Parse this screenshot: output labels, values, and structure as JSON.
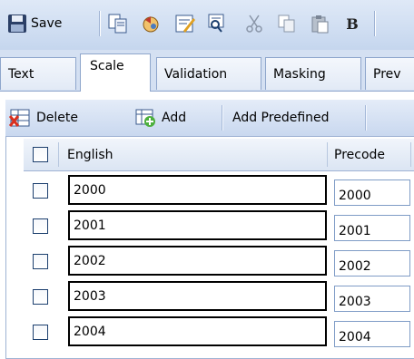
{
  "toolbar": {
    "save_label": "Save",
    "bold_label": "B",
    "buttons": [
      "save-icon",
      "copy-icon",
      "undo-icon",
      "spellcheck-icon",
      "find-replace-icon",
      "cut-icon",
      "copy-small-icon",
      "paste-icon",
      "bold-icon"
    ]
  },
  "tabs": [
    {
      "label": "Text",
      "active": false
    },
    {
      "label": "Scale",
      "active": true
    },
    {
      "label": "Validation",
      "active": false
    },
    {
      "label": "Masking",
      "active": false
    },
    {
      "label": "Prev",
      "active": false
    }
  ],
  "actions": {
    "delete_label": "Delete",
    "add_label": "Add",
    "add_predefined_label": "Add Predefined"
  },
  "grid": {
    "col_english": "English",
    "col_precode": "Precode",
    "rows": [
      {
        "english": "2000",
        "precode": "2000"
      },
      {
        "english": "2001",
        "precode": "2001"
      },
      {
        "english": "2002",
        "precode": "2002"
      },
      {
        "english": "2003",
        "precode": "2003"
      },
      {
        "english": "2004",
        "precode": "2004"
      }
    ]
  },
  "colors": {
    "toolbar_bg": "#c5d6ee",
    "border": "#8ea6cc",
    "checkbox_border": "#1c3f6e"
  }
}
